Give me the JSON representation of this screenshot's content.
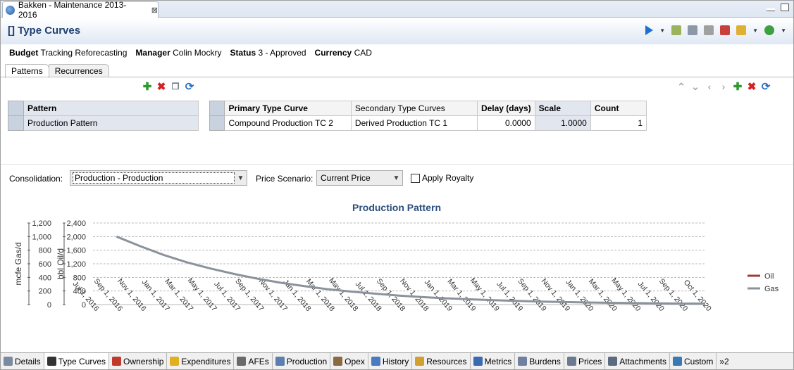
{
  "editor_tab": {
    "title": "Bakken - Maintenance 2013-2016",
    "close": "⊠"
  },
  "header": {
    "title": "[] Type Curves"
  },
  "info": [
    {
      "label": "Budget",
      "value": "Tracking  Reforecasting"
    },
    {
      "label": "Manager",
      "value": "Colin Mockry"
    },
    {
      "label": "Status",
      "value": "3 - Approved"
    },
    {
      "label": "Currency",
      "value": "CAD"
    }
  ],
  "subtabs": [
    {
      "label": "Patterns"
    },
    {
      "label": "Recurrences"
    }
  ],
  "pattern_table": {
    "header": "Pattern",
    "rows": [
      "Production Pattern"
    ]
  },
  "type_curve_table": {
    "headers": [
      "Primary Type Curve",
      "Secondary Type Curves",
      "Delay (days)",
      "Scale",
      "Count"
    ],
    "rows": [
      [
        "Compound Production TC 2",
        "Derived Production TC 1",
        "0.0000",
        "1.0000",
        "1"
      ]
    ]
  },
  "form": {
    "consolidation_label": "Consolidation:",
    "consolidation_value": "Production - Production",
    "price_label": "Price Scenario:",
    "price_value": "Current Price",
    "royalty_label": "Apply Royalty"
  },
  "chart_data": {
    "type": "line",
    "title": "Production Pattern",
    "title_color": "#2c4f7c",
    "y_left_label": "mcfe Gas/d",
    "y_left_ticks": [
      "1,200",
      "1,000",
      "800",
      "600",
      "400",
      "200",
      "0"
    ],
    "y_right_label": "bbl Oil/d",
    "y_right_ticks": [
      "2,400",
      "2,000",
      "1,600",
      "1,200",
      "800",
      "400",
      "0"
    ],
    "ylim": [
      0,
      2400
    ],
    "x_ticks": [
      "Jul 1, 2016",
      "Sep 1, 2016",
      "Nov 1, 2016",
      "Jan 1, 2017",
      "Mar 1, 2017",
      "May 1, 2017",
      "Jul 1, 2017",
      "Sep 1, 2017",
      "Nov 1, 2017",
      "Jan 1, 2018",
      "Mar 1, 2018",
      "May 1, 2018",
      "Jul 1, 2018",
      "Sep 1, 2018",
      "Nov 1, 2018",
      "Jan 1, 2019",
      "Mar 1, 2019",
      "May 1, 2019",
      "Jul 1, 2019",
      "Sep 1, 2019",
      "Nov 1, 2019",
      "Jan 1, 2020",
      "Mar 1, 2020",
      "May 1, 2020",
      "Jul 1, 2020",
      "Sep 1, 2020",
      "Oct 1, 2020"
    ],
    "series": [
      {
        "name": "Oil",
        "color": "#a33a3a",
        "values": []
      },
      {
        "name": "Gas",
        "color": "#8a929c",
        "points": [
          [
            "Sep 1, 2016",
            2000
          ],
          [
            "Nov 1, 2016",
            1720
          ],
          [
            "Jan 1, 2017",
            1460
          ],
          [
            "Mar 1, 2017",
            1240
          ],
          [
            "May 1, 2017",
            1060
          ],
          [
            "Jul 1, 2017",
            900
          ],
          [
            "Sep 1, 2017",
            760
          ],
          [
            "Nov 1, 2017",
            640
          ],
          [
            "Jan 1, 2018",
            540
          ],
          [
            "Mar 1, 2018",
            450
          ],
          [
            "May 1, 2018",
            380
          ],
          [
            "Jul 1, 2018",
            320
          ],
          [
            "Sep 1, 2018",
            265
          ],
          [
            "Nov 1, 2018",
            220
          ],
          [
            "Jan 1, 2019",
            185
          ],
          [
            "Mar 1, 2019",
            155
          ],
          [
            "May 1, 2019",
            130
          ],
          [
            "Jul 1, 2019",
            108
          ],
          [
            "Sep 1, 2019",
            90
          ],
          [
            "Nov 1, 2019",
            75
          ],
          [
            "Jan 1, 2020",
            62
          ],
          [
            "Mar 1, 2020",
            52
          ],
          [
            "May 1, 2020",
            43
          ],
          [
            "Jul 1, 2020",
            36
          ],
          [
            "Sep 1, 2020",
            30
          ],
          [
            "Oct 1, 2020",
            28
          ]
        ]
      }
    ],
    "legend_position": "right",
    "grid": true
  },
  "bottom_tabs": [
    {
      "label": "Details",
      "icon": "details-icon",
      "color": "#7a8aa0"
    },
    {
      "label": "Type Curves",
      "icon": "type-curves-icon",
      "color": "#333333"
    },
    {
      "label": "Ownership",
      "icon": "ownership-icon",
      "color": "#c0392b"
    },
    {
      "label": "Expenditures",
      "icon": "expenditures-icon",
      "color": "#e0b020"
    },
    {
      "label": "AFEs",
      "icon": "afes-icon",
      "color": "#6a6a6a"
    },
    {
      "label": "Production",
      "icon": "production-icon",
      "color": "#5a7fb0"
    },
    {
      "label": "Opex",
      "icon": "opex-icon",
      "color": "#8a6a40"
    },
    {
      "label": "History",
      "icon": "history-icon",
      "color": "#4a7ac0"
    },
    {
      "label": "Resources",
      "icon": "resources-icon",
      "color": "#d0a030"
    },
    {
      "label": "Metrics",
      "icon": "metrics-icon",
      "color": "#3a6ab0"
    },
    {
      "label": "Burdens",
      "icon": "burdens-icon",
      "color": "#7080a0"
    },
    {
      "label": "Prices",
      "icon": "prices-icon",
      "color": "#6a7a90"
    },
    {
      "label": "Attachments",
      "icon": "attachments-icon",
      "color": "#5a6a80"
    },
    {
      "label": "Custom",
      "icon": "custom-icon",
      "color": "#3a7ab0"
    }
  ],
  "overflow_label": "»2"
}
